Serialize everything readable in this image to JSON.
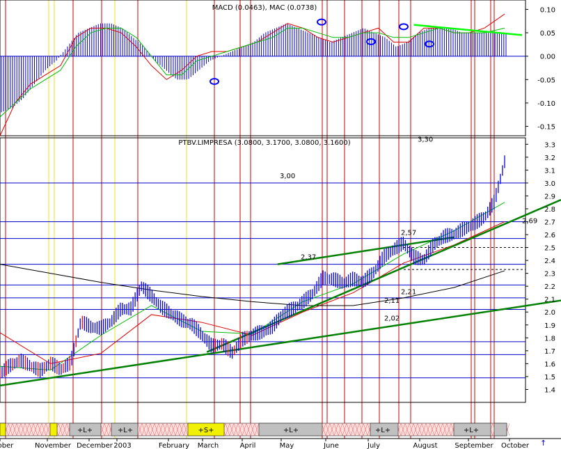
{
  "macd_title": "MACD (0.0463), MAC (0.0738)",
  "price_title": "PTBV.LIMPRESA (3.0800, 3.1700, 3.0800, 3.1600)",
  "colors": {
    "grid_blue": "#0000cc",
    "vline_red": "#cc0000",
    "vline_yellow": "#f0e020",
    "price": "#0000ee",
    "down_bar": "#ff0000",
    "ma_green": "#00bb00",
    "ma_red": "#dd0000",
    "ma_black": "#000000",
    "trend": "#008000",
    "macd_hist": "#0000cc",
    "signal_line": "#00ff00"
  },
  "months": [
    "ober",
    "November",
    "December",
    "2003",
    "February",
    "March",
    "April",
    "May",
    "June",
    "July",
    "August",
    "September",
    "October"
  ],
  "bottom_labels": [
    "+L+",
    "+L+",
    "+S+",
    "+L+",
    "+L+",
    "+L+"
  ],
  "chart_data": [
    {
      "type": "line",
      "panel": "MACD",
      "title": "MACD (0.0463), MAC (0.0738)",
      "ylim": [
        -0.17,
        0.12
      ],
      "yticks": [
        0.1,
        0.05,
        0.0,
        -0.05,
        -0.1,
        -0.15
      ],
      "ytick_labels": [
        "0.10",
        "0.05",
        "0.00",
        "-0.05",
        "-0.10",
        "-0.15"
      ],
      "x": [
        0,
        0.03,
        0.06,
        0.09,
        0.12,
        0.15,
        0.18,
        0.21,
        0.24,
        0.27,
        0.3,
        0.33,
        0.36,
        0.39,
        0.42,
        0.45,
        0.48,
        0.51,
        0.54,
        0.57,
        0.6,
        0.63,
        0.66,
        0.69,
        0.72,
        0.75,
        0.78,
        0.81,
        0.84,
        0.87,
        0.9,
        0.93,
        0.96,
        1.0
      ],
      "series": [
        {
          "values": [
            -0.17,
            -0.1,
            -0.06,
            -0.04,
            -0.02,
            0.04,
            0.06,
            0.06,
            0.05,
            0.02,
            -0.02,
            -0.05,
            -0.03,
            0.0,
            0.01,
            0.01,
            0.02,
            0.03,
            0.05,
            0.07,
            0.06,
            0.04,
            0.03,
            0.04,
            0.05,
            0.06,
            0.03,
            0.03,
            0.06,
            0.06,
            0.05,
            0.05,
            0.06,
            0.09
          ]
        },
        {
          "values": [
            -0.13,
            -0.1,
            -0.07,
            -0.05,
            -0.03,
            0.02,
            0.05,
            0.06,
            0.06,
            0.04,
            0.0,
            -0.04,
            -0.04,
            -0.01,
            0.0,
            0.01,
            0.02,
            0.03,
            0.04,
            0.06,
            0.06,
            0.05,
            0.04,
            0.04,
            0.05,
            0.05,
            0.04,
            0.04,
            0.05,
            0.06,
            0.05,
            0.05,
            0.05,
            0.06
          ]
        }
      ],
      "histogram": [
        -0.12,
        -0.11,
        -0.09,
        -0.06,
        -0.03,
        -0.01,
        0.02,
        0.05,
        0.06,
        0.07,
        0.07,
        0.06,
        0.04,
        0.02,
        -0.01,
        -0.03,
        -0.05,
        -0.05,
        -0.03,
        -0.01,
        0.0,
        0.01,
        0.02,
        0.03,
        0.05,
        0.06,
        0.07,
        0.06,
        0.05,
        0.04,
        0.03,
        0.04,
        0.05,
        0.06,
        0.05,
        0.04,
        0.02,
        0.03,
        0.05,
        0.06,
        0.06,
        0.06,
        0.05,
        0.05,
        0.05,
        0.05,
        0.05
      ],
      "signal_trend": {
        "x": [
          0.82,
          1.0
        ],
        "y": [
          0.067,
          0.045
        ]
      }
    },
    {
      "type": "line",
      "panel": "Price",
      "title": "PTBV.LIMPRESA (3.0800, 3.1700, 3.0800, 3.1600)",
      "ylim": [
        1.3,
        3.35
      ],
      "yticks": [
        3.3,
        3.2,
        3.1,
        3.0,
        2.9,
        2.8,
        2.7,
        2.6,
        2.5,
        2.4,
        2.3,
        2.2,
        2.1,
        2.0,
        1.9,
        1.8,
        1.7,
        1.6,
        1.5,
        1.4
      ],
      "ytick_labels": [
        "3.3",
        "3.2",
        "3.1",
        "3.0",
        "2.9",
        "2.8",
        "2.7",
        "2.6",
        "2.5",
        "2.4",
        "2.3",
        "2.2",
        "2.1",
        "2.0",
        "1.9",
        "1.8",
        "1.7",
        "1.6",
        "1.5",
        "1.4"
      ],
      "price": {
        "x": [
          0,
          0.02,
          0.04,
          0.06,
          0.08,
          0.1,
          0.12,
          0.14,
          0.16,
          0.18,
          0.2,
          0.22,
          0.24,
          0.26,
          0.28,
          0.3,
          0.32,
          0.34,
          0.36,
          0.38,
          0.4,
          0.42,
          0.44,
          0.46,
          0.48,
          0.5,
          0.52,
          0.54,
          0.56,
          0.58,
          0.6,
          0.62,
          0.64,
          0.66,
          0.68,
          0.7,
          0.72,
          0.74,
          0.76,
          0.78,
          0.8,
          0.82,
          0.84,
          0.86,
          0.88,
          0.9,
          0.92,
          0.94,
          0.96,
          0.98,
          1.0
        ],
        "values": [
          1.52,
          1.58,
          1.62,
          1.58,
          1.54,
          1.6,
          1.55,
          1.6,
          1.92,
          1.88,
          1.87,
          1.92,
          2.02,
          2.02,
          2.2,
          2.12,
          2.03,
          1.98,
          1.93,
          1.9,
          1.82,
          1.73,
          1.75,
          1.68,
          1.78,
          1.82,
          1.84,
          1.88,
          1.98,
          2.02,
          2.07,
          2.14,
          2.26,
          2.25,
          2.22,
          2.25,
          2.23,
          2.3,
          2.42,
          2.48,
          2.53,
          2.42,
          2.4,
          2.52,
          2.58,
          2.6,
          2.64,
          2.68,
          2.73,
          2.85,
          3.16
        ]
      },
      "moving_averages": [
        {
          "color": "green",
          "x": [
            0,
            0.1,
            0.2,
            0.3,
            0.4,
            0.5,
            0.6,
            0.7,
            0.8,
            0.9,
            1.0
          ],
          "values": [
            1.58,
            1.55,
            1.82,
            2.05,
            1.85,
            1.83,
            2.08,
            2.22,
            2.45,
            2.63,
            2.85
          ]
        },
        {
          "color": "red",
          "x": [
            0,
            0.1,
            0.2,
            0.3,
            0.4,
            0.5,
            0.6,
            0.7,
            0.8,
            0.9,
            1.0
          ],
          "values": [
            1.84,
            1.6,
            1.68,
            1.98,
            1.92,
            1.82,
            2.0,
            2.15,
            2.38,
            2.52,
            2.7
          ]
        },
        {
          "color": "black",
          "x": [
            0,
            0.1,
            0.2,
            0.3,
            0.4,
            0.5,
            0.6,
            0.7,
            0.8,
            0.9,
            1.0
          ],
          "values": [
            2.37,
            2.3,
            2.23,
            2.17,
            2.12,
            2.08,
            2.05,
            2.05,
            2.11,
            2.19,
            2.32
          ]
        }
      ],
      "trendlines": [
        {
          "x": [
            0,
            1.0
          ],
          "y": [
            1.43,
            2.09
          ]
        },
        {
          "x": [
            0.41,
            1.0
          ],
          "y": [
            1.69,
            2.87
          ]
        },
        {
          "x": [
            0.55,
            0.9
          ],
          "y": [
            2.37,
            2.58
          ]
        }
      ],
      "horizontal_levels": [
        3.0,
        2.7,
        2.57,
        2.37,
        2.21,
        2.11,
        2.02,
        1.77,
        1.67,
        1.49
      ],
      "dashed_levels": [
        2.5,
        2.33
      ],
      "annotations": [
        {
          "text": "3,30",
          "value": 3.3
        },
        {
          "text": "3,00",
          "value": 3.0
        },
        {
          "text": "2,69",
          "value": 2.69
        },
        {
          "text": "2,57",
          "value": 2.57
        },
        {
          "text": "2,37",
          "value": 2.37
        },
        {
          "text": "2,21",
          "value": 2.21
        },
        {
          "text": "2,11",
          "value": 2.11
        },
        {
          "text": "2,02",
          "value": 2.02
        }
      ]
    }
  ]
}
